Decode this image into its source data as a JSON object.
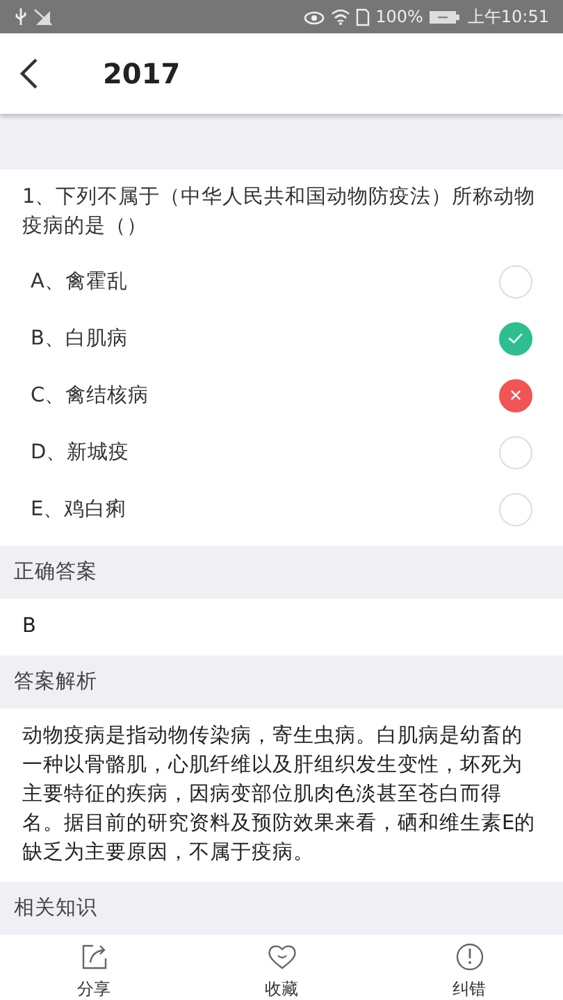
{
  "status_bar": {
    "battery_percent": "100%",
    "time": "上午10:51"
  },
  "header": {
    "title": "2017"
  },
  "question": {
    "text": "1、下列不属于（中华人民共和国动物防疫法）所称动物疫病的是（）",
    "options": [
      {
        "label": "A、禽霍乱",
        "correct": false,
        "wrong": false
      },
      {
        "label": "B、白肌病",
        "correct": true,
        "wrong": false
      },
      {
        "label": "C、禽结核病",
        "correct": false,
        "wrong": true
      },
      {
        "label": "D、新城疫",
        "correct": false,
        "wrong": false
      },
      {
        "label": "E、鸡白痢",
        "correct": false,
        "wrong": false
      }
    ]
  },
  "sections": [
    {
      "title": "正确答案",
      "body": "B"
    },
    {
      "title": "答案解析",
      "body": "动物疫病是指动物传染病，寄生虫病。白肌病是幼畜的一种以骨骼肌，心肌纤维以及肝组织发生变性，坏死为主要特征的疾病，因病变部位肌肉色淡甚至苍白而得名。据目前的研究资料及预防效果来看，硒和维生素E的缺乏为主要原因，不属于疫病。"
    },
    {
      "title": "相关知识"
    }
  ],
  "bottom_bar": [
    {
      "kind": "share",
      "label": "分享"
    },
    {
      "kind": "favorite",
      "label": "收藏"
    },
    {
      "kind": "report",
      "label": "纠错"
    }
  ]
}
